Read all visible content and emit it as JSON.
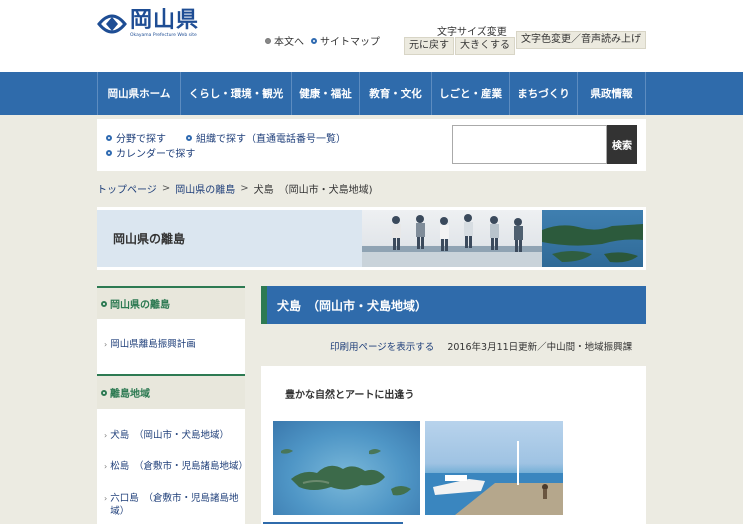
{
  "header": {
    "logo_text": "岡山県",
    "logo_sub": "Okayama Prefecture Web site",
    "links": [
      {
        "label": "本文へ"
      },
      {
        "label": "サイトマップ"
      }
    ],
    "font_size_label": "文字サイズ変更",
    "font_reset_label": "元に戻す",
    "font_larger_label": "大きくする",
    "color_voice_label": "文字色変更／音声読み上げ"
  },
  "nav": {
    "items": [
      {
        "label": "岡山県ホーム"
      },
      {
        "label": "くらし・環境・観光"
      },
      {
        "label": "健康・福祉"
      },
      {
        "label": "教育・文化"
      },
      {
        "label": "しごと・産業"
      },
      {
        "label": "まちづくり"
      },
      {
        "label": "県政情報"
      }
    ]
  },
  "search": {
    "links": [
      {
        "label": "分野で探す"
      },
      {
        "label": "組織で探す（直通電話番号一覧）"
      },
      {
        "label": "カレンダーで探す"
      }
    ],
    "button_label": "検索",
    "placeholder": ""
  },
  "breadcrumb": {
    "items": [
      {
        "label": "トップページ"
      },
      {
        "label": "岡山県の離島"
      },
      {
        "label": "犬島　（岡山市・犬島地域)"
      }
    ],
    "separator": ">"
  },
  "banner": {
    "title": "岡山県の離島"
  },
  "sidebar": {
    "section1": {
      "title": "岡山県の離島",
      "items": [
        {
          "label": "岡山県離島振興計画"
        }
      ]
    },
    "section2": {
      "title": "離島地域",
      "items": [
        {
          "label": "犬島　（岡山市・犬島地域）"
        },
        {
          "label": "松島　（倉敷市・児島諸島地域）"
        },
        {
          "label": "六口島　（倉敷市・児島諸島地域）"
        }
      ]
    }
  },
  "main": {
    "title": "犬島　（岡山市・犬島地域）",
    "print_label": "印刷用ページを表示する",
    "updated": "2016年3月11日更新／中山間・地域振興課",
    "heading": "豊かな自然とアートに出逢う"
  },
  "colors": {
    "nav_blue": "#2f6bab",
    "accent_green": "#2d7a52",
    "link_blue": "#1f3f7a",
    "page_bg": "#ecebe2"
  }
}
